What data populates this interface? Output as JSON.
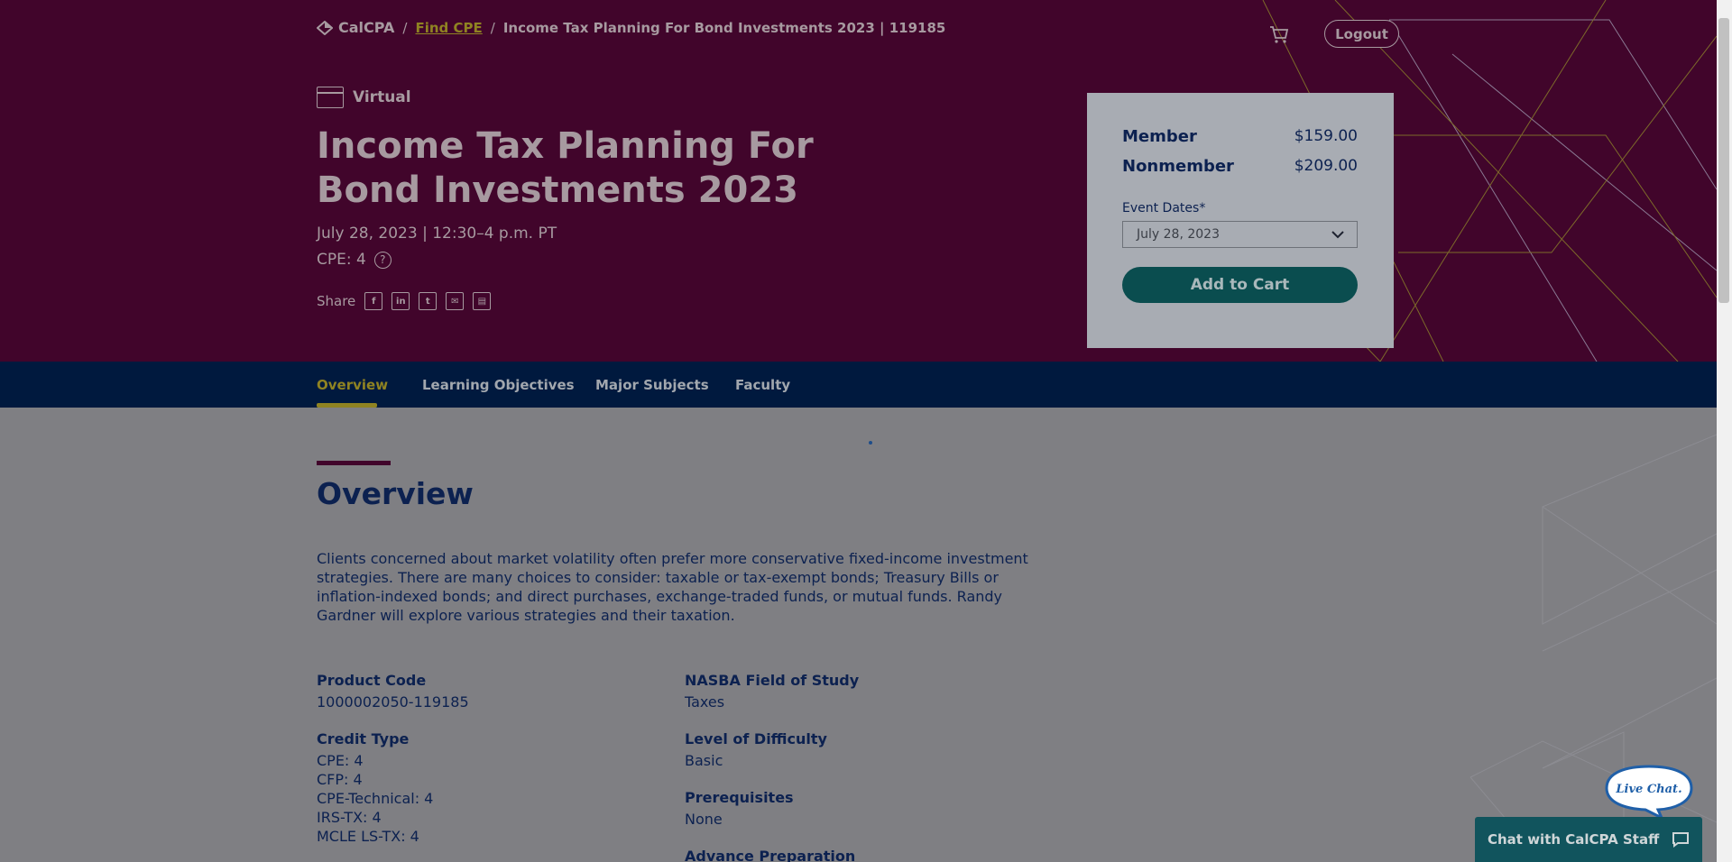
{
  "brand": {
    "logo_text": "CalCPA"
  },
  "breadcrumb": {
    "separator": "/",
    "find_cpe": "Find CPE",
    "current": "Income Tax Planning For Bond Investments 2023 | 119185"
  },
  "header": {
    "logout_label": "Logout",
    "cart_icon": "cart-icon"
  },
  "event": {
    "format": "Virtual",
    "title": "Income Tax Planning For Bond Investments 2023",
    "datetime": "July 28, 2023 | 12:30–4 p.m. PT",
    "cpe": "CPE: 4",
    "help_glyph": "?",
    "share_label": "Share",
    "share_icons": [
      "facebook-icon",
      "linkedin-icon",
      "twitter-icon",
      "email-icon",
      "calendar-icon"
    ]
  },
  "pricing": {
    "member_label": "Member",
    "member_price": "$159.00",
    "nonmember_label": "Nonmember",
    "nonmember_price": "$209.00",
    "dates_label": "Event Dates*",
    "selected_date": "July 28, 2023",
    "add_to_cart": "Add to Cart"
  },
  "tabs": [
    {
      "label": "Overview",
      "active": true
    },
    {
      "label": "Learning Objectives",
      "active": false
    },
    {
      "label": "Major Subjects",
      "active": false
    },
    {
      "label": "Faculty",
      "active": false
    }
  ],
  "overview": {
    "heading": "Overview",
    "description": "Clients concerned about market volatility often prefer more conservative fixed-income investment strategies. There are many choices to consider: taxable or tax-exempt bonds; Treasury Bills or inflation-indexed bonds; and direct purchases, exchange-traded funds, or mutual funds. Randy Gardner will explore various strategies and their taxation."
  },
  "details_left": {
    "product_code_label": "Product Code",
    "product_code": "1000002050-119185",
    "credit_type_label": "Credit Type",
    "credits": [
      "CPE: 4",
      "CFP: 4",
      "CPE-Technical: 4",
      "IRS-TX: 4",
      "MCLE LS-TX: 4"
    ]
  },
  "details_right": {
    "field_label": "NASBA Field of Study",
    "field_value": "Taxes",
    "difficulty_label": "Level of Difficulty",
    "difficulty_value": "Basic",
    "prereq_label": "Prerequisites",
    "prereq_value": "None",
    "advance_label": "Advance Preparation"
  },
  "chat": {
    "bubble_text": "Live Chat.",
    "bar_label": "Chat with CalCPA Staff"
  },
  "colors": {
    "hero_bg": "#41052b",
    "navy": "#00193e",
    "accent_gold": "#8f8322",
    "teal": "#0a4d4f"
  }
}
